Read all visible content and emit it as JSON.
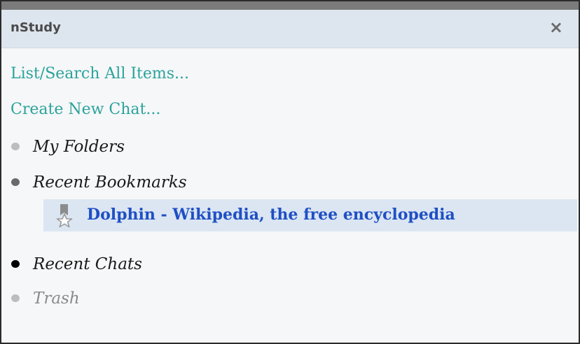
{
  "panel": {
    "title": "nStudy",
    "close_symbol": "×",
    "close_icon": "close-icon"
  },
  "actions": {
    "list_search": "List/Search All Items...",
    "create_chat": "Create New Chat..."
  },
  "tree": {
    "my_folders": {
      "label": "My Folders",
      "bullet_color": "#bdbdbd"
    },
    "recent_bookmarks": {
      "label": "Recent Bookmarks",
      "bullet_color": "#6a6a6a",
      "items": [
        {
          "title": "Dolphin - Wikipedia, the free encyclopedia",
          "icon": "bookmark-star-icon"
        }
      ]
    },
    "recent_chats": {
      "label": "Recent Chats",
      "bullet_color": "#000000"
    },
    "trash": {
      "label": "Trash",
      "bullet_color": "#bdbdbd",
      "label_color": "#8a8a8a"
    }
  },
  "colors": {
    "link": "#2aa39c",
    "titlebar_bg": "#dde5ee",
    "selected_bg": "#dbe6f2",
    "bookmark_text": "#1f4fc4"
  }
}
